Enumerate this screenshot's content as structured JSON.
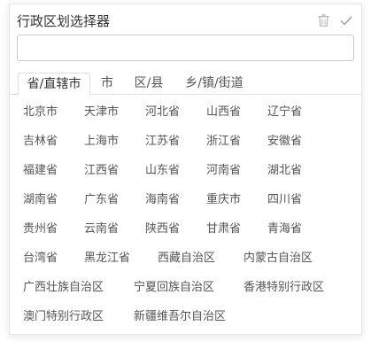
{
  "header": {
    "title": "行政区划选择器"
  },
  "search": {
    "value": "",
    "placeholder": ""
  },
  "tabs": [
    {
      "label": "省/直辖市",
      "active": true
    },
    {
      "label": "市",
      "active": false
    },
    {
      "label": "区/县",
      "active": false
    },
    {
      "label": "乡/镇/街道",
      "active": false
    }
  ],
  "regions": [
    "北京市",
    "天津市",
    "河北省",
    "山西省",
    "辽宁省",
    "吉林省",
    "上海市",
    "江苏省",
    "浙江省",
    "安徽省",
    "福建省",
    "江西省",
    "山东省",
    "河南省",
    "湖北省",
    "湖南省",
    "广东省",
    "海南省",
    "重庆市",
    "四川省",
    "贵州省",
    "云南省",
    "陕西省",
    "甘肃省",
    "青海省",
    "台湾省",
    "黑龙江省",
    "西藏自治区",
    "内蒙古自治区",
    "广西壮族自治区",
    "宁夏回族自治区",
    "香港特别行政区",
    "澳门特别行政区",
    "新疆维吾尔自治区"
  ],
  "colors": {
    "text": "#555555",
    "title": "#333333",
    "border": "#dddddd"
  },
  "icons": {
    "delete": "trash-icon",
    "confirm": "check-icon"
  }
}
